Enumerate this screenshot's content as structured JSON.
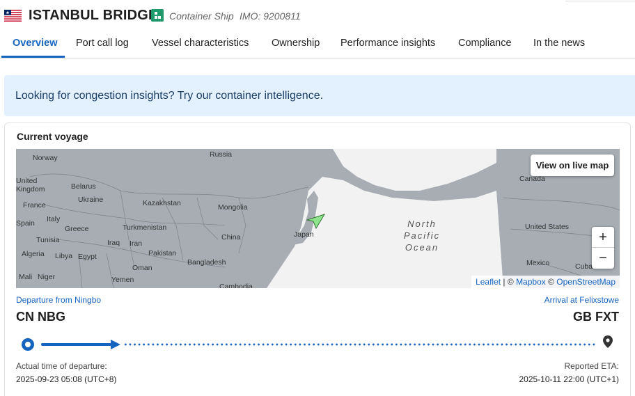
{
  "vessel": {
    "flag": "liberia-flag",
    "name": "ISTANBUL BRIDGE",
    "type_icon": "container-ship-icon",
    "type": "Container Ship",
    "imo": "IMO: 9200811"
  },
  "tabs": [
    {
      "label": "Overview",
      "active": true
    },
    {
      "label": "Port call log",
      "active": false
    },
    {
      "label": "Vessel characteristics",
      "active": false
    },
    {
      "label": "Ownership",
      "active": false
    },
    {
      "label": "Performance insights",
      "active": false
    },
    {
      "label": "Compliance",
      "active": false
    },
    {
      "label": "In the news",
      "active": false
    }
  ],
  "banner": {
    "text": "Looking for congestion insights? Try our container intelligence."
  },
  "voyage": {
    "title": "Current voyage",
    "map": {
      "live_map_button": "View on live map",
      "zoom_in": "+",
      "zoom_out": "−",
      "attribution": {
        "leaflet": "Leaflet",
        "sep1": " | © ",
        "mapbox": "Mapbox",
        "sep2": " © ",
        "osm": "OpenStreetMap"
      },
      "ocean": [
        "North",
        "Pacific",
        "Ocean"
      ],
      "labels": {
        "russia": "Russia",
        "norway": "Norway",
        "united_kingdom": "United\nKingdom",
        "belarus": "Belarus",
        "ukraine": "Ukraine",
        "france": "France",
        "kazakhstan": "Kazakhstan",
        "mongolia": "Mongolia",
        "italy": "Italy",
        "spain": "Spain",
        "greece": "Greece",
        "turkmenistan": "Turkmenistan",
        "china": "China",
        "japan": "Japan",
        "tunisia": "Tunisia",
        "iraq": "Iraq",
        "iran": "Iran",
        "algeria": "Algeria",
        "libya": "Libya",
        "egypt": "Egypt",
        "pakistan": "Pakistan",
        "bangladesh": "Bangladesh",
        "oman": "Oman",
        "mali": "Mali",
        "niger": "Niger",
        "yemen": "Yemen",
        "cambodia": "Cambodia",
        "canada": "Canada",
        "united_states": "United States",
        "mexico": "Mexico",
        "cuba": "Cuba"
      },
      "vessel_marker_color": "#8ee58e"
    },
    "departure": {
      "label": "Departure from Ningbo",
      "code": "CN NBG",
      "time_label": "Actual time of departure:",
      "time": "2025-09-23 05:08 (UTC+8)"
    },
    "arrival": {
      "label": "Arrival at Felixstowe",
      "code": "GB FXT",
      "time_label": "Reported ETA:",
      "time": "2025-10-11 22:00 (UTC+1)"
    },
    "progress_fraction": 0.14
  },
  "colors": {
    "accent": "#1565c0",
    "banner_bg": "#e3f0fd",
    "type_badge": "#1f9a6a",
    "land": "#f2f2f2",
    "water": "#a7adb3"
  }
}
